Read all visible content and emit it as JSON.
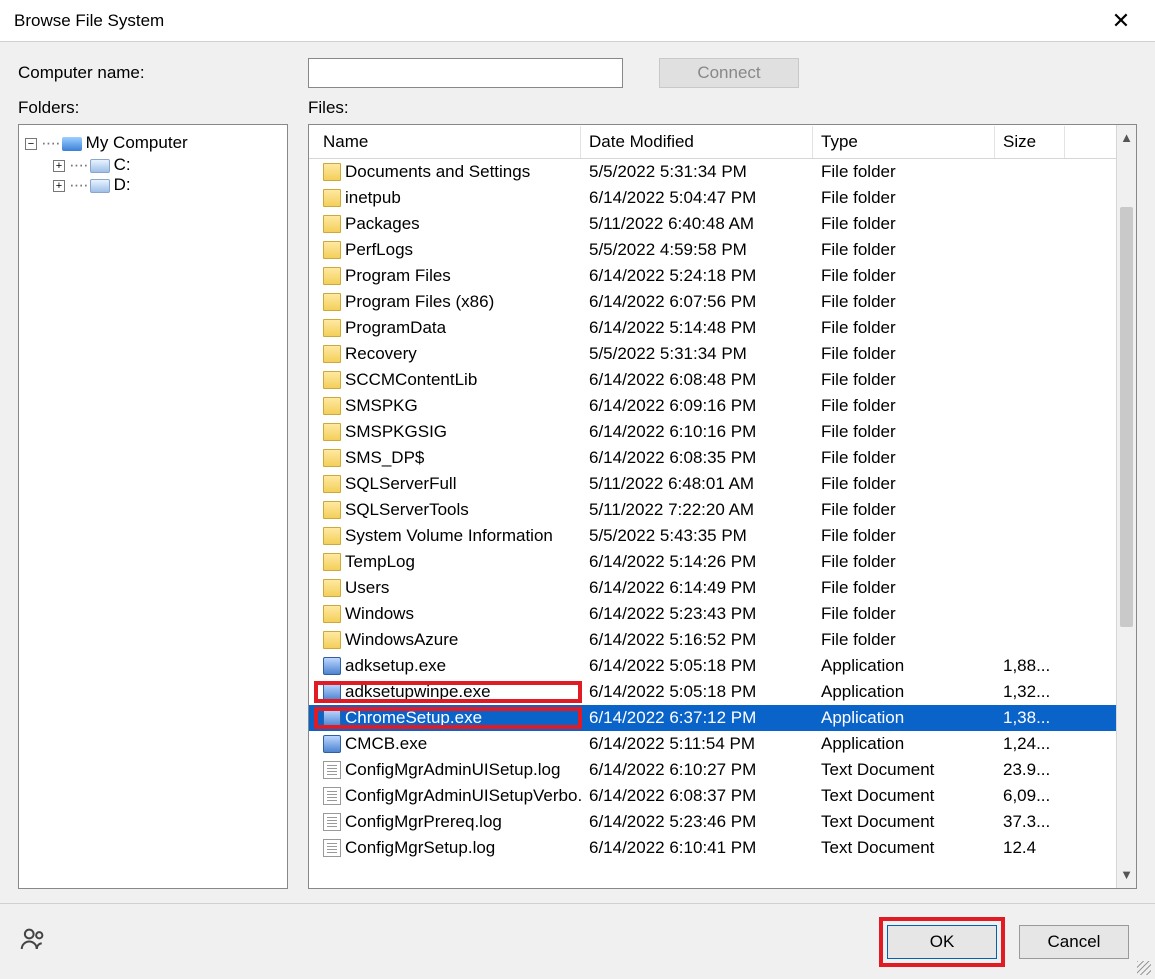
{
  "title": "Browse File System",
  "labels": {
    "computer_name": "Computer name:",
    "folders": "Folders:",
    "files": "Files:"
  },
  "buttons": {
    "connect": "Connect",
    "ok": "OK",
    "cancel": "Cancel"
  },
  "input": {
    "computer_name_value": ""
  },
  "tree": {
    "root_label": "My Computer",
    "drives": [
      "C:",
      "D:"
    ]
  },
  "columns": {
    "name": "Name",
    "date": "Date Modified",
    "type": "Type",
    "size": "Size"
  },
  "selected_index": 20,
  "files": [
    {
      "name": "Documents and Settings",
      "date": "5/5/2022 5:31:34 PM",
      "type": "File folder",
      "size": "",
      "kind": "folder"
    },
    {
      "name": "inetpub",
      "date": "6/14/2022 5:04:47 PM",
      "type": "File folder",
      "size": "",
      "kind": "folder"
    },
    {
      "name": "Packages",
      "date": "5/11/2022 6:40:48 AM",
      "type": "File folder",
      "size": "",
      "kind": "folder"
    },
    {
      "name": "PerfLogs",
      "date": "5/5/2022 4:59:58 PM",
      "type": "File folder",
      "size": "",
      "kind": "folder"
    },
    {
      "name": "Program Files",
      "date": "6/14/2022 5:24:18 PM",
      "type": "File folder",
      "size": "",
      "kind": "folder"
    },
    {
      "name": "Program Files (x86)",
      "date": "6/14/2022 6:07:56 PM",
      "type": "File folder",
      "size": "",
      "kind": "folder"
    },
    {
      "name": "ProgramData",
      "date": "6/14/2022 5:14:48 PM",
      "type": "File folder",
      "size": "",
      "kind": "folder"
    },
    {
      "name": "Recovery",
      "date": "5/5/2022 5:31:34 PM",
      "type": "File folder",
      "size": "",
      "kind": "folder"
    },
    {
      "name": "SCCMContentLib",
      "date": "6/14/2022 6:08:48 PM",
      "type": "File folder",
      "size": "",
      "kind": "folder"
    },
    {
      "name": "SMSPKG",
      "date": "6/14/2022 6:09:16 PM",
      "type": "File folder",
      "size": "",
      "kind": "folder"
    },
    {
      "name": "SMSPKGSIG",
      "date": "6/14/2022 6:10:16 PM",
      "type": "File folder",
      "size": "",
      "kind": "folder"
    },
    {
      "name": "SMS_DP$",
      "date": "6/14/2022 6:08:35 PM",
      "type": "File folder",
      "size": "",
      "kind": "folder"
    },
    {
      "name": "SQLServerFull",
      "date": "5/11/2022 6:48:01 AM",
      "type": "File folder",
      "size": "",
      "kind": "folder"
    },
    {
      "name": "SQLServerTools",
      "date": "5/11/2022 7:22:20 AM",
      "type": "File folder",
      "size": "",
      "kind": "folder"
    },
    {
      "name": "System Volume Information",
      "date": "5/5/2022 5:43:35 PM",
      "type": "File folder",
      "size": "",
      "kind": "folder"
    },
    {
      "name": "TempLog",
      "date": "6/14/2022 5:14:26 PM",
      "type": "File folder",
      "size": "",
      "kind": "folder"
    },
    {
      "name": "Users",
      "date": "6/14/2022 6:14:49 PM",
      "type": "File folder",
      "size": "",
      "kind": "folder"
    },
    {
      "name": "Windows",
      "date": "6/14/2022 5:23:43 PM",
      "type": "File folder",
      "size": "",
      "kind": "folder"
    },
    {
      "name": "WindowsAzure",
      "date": "6/14/2022 5:16:52 PM",
      "type": "File folder",
      "size": "",
      "kind": "folder"
    },
    {
      "name": "adksetup.exe",
      "date": "6/14/2022 5:05:18 PM",
      "type": "Application",
      "size": "1,88...",
      "kind": "app"
    },
    {
      "name": "adksetupwinpe.exe",
      "date": "6/14/2022 5:05:18 PM",
      "type": "Application",
      "size": "1,32...",
      "kind": "app"
    },
    {
      "name": "ChromeSetup.exe",
      "date": "6/14/2022 6:37:12 PM",
      "type": "Application",
      "size": "1,38...",
      "kind": "app"
    },
    {
      "name": "CMCB.exe",
      "date": "6/14/2022 5:11:54 PM",
      "type": "Application",
      "size": "1,24...",
      "kind": "app"
    },
    {
      "name": "ConfigMgrAdminUISetup.log",
      "date": "6/14/2022 6:10:27 PM",
      "type": "Text Document",
      "size": "23.9...",
      "kind": "doc"
    },
    {
      "name": "ConfigMgrAdminUISetupVerbo...",
      "date": "6/14/2022 6:08:37 PM",
      "type": "Text Document",
      "size": "6,09...",
      "kind": "doc"
    },
    {
      "name": "ConfigMgrPrereq.log",
      "date": "6/14/2022 5:23:46 PM",
      "type": "Text Document",
      "size": "37.3...",
      "kind": "doc"
    },
    {
      "name": "ConfigMgrSetup.log",
      "date": "6/14/2022 6:10:41 PM",
      "type": "Text Document",
      "size": "12.4",
      "kind": "doc"
    }
  ]
}
